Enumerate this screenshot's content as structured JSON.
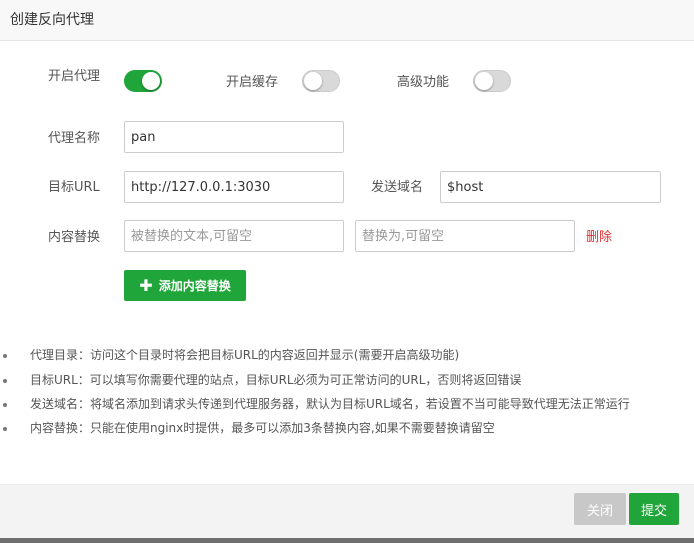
{
  "dialog": {
    "title": "创建反向代理"
  },
  "toggles": {
    "proxy": {
      "label": "开启代理",
      "on": true
    },
    "cache": {
      "label": "开启缓存",
      "on": false
    },
    "advanced": {
      "label": "高级功能",
      "on": false
    }
  },
  "fields": {
    "name": {
      "label": "代理名称",
      "value": "pan"
    },
    "target_url": {
      "label": "目标URL",
      "value": "http://127.0.0.1:3030"
    },
    "send_domain": {
      "label": "发送域名",
      "value": "$host"
    },
    "replace": {
      "label": "内容替换",
      "from_placeholder": "被替换的文本,可留空",
      "to_placeholder": "替换为,可留空",
      "delete_label": "删除"
    }
  },
  "add_button": {
    "label": "添加内容替换",
    "icon": "plus-icon"
  },
  "help": [
    "代理目录：访问这个目录时将会把目标URL的内容返回并显示(需要开启高级功能)",
    "目标URL：可以填写你需要代理的站点，目标URL必须为可正常访问的URL，否则将返回错误",
    "发送域名：将域名添加到请求头传递到代理服务器，默认为目标URL域名，若设置不当可能导致代理无法正常运行",
    "内容替换：只能在使用nginx时提供，最多可以添加3条替换内容,如果不需要替换请留空"
  ],
  "footer": {
    "close_label": "关闭",
    "submit_label": "提交"
  },
  "colors": {
    "accent": "#20a53a",
    "danger": "#e12f2f",
    "disabled": "#c8c8c8"
  }
}
